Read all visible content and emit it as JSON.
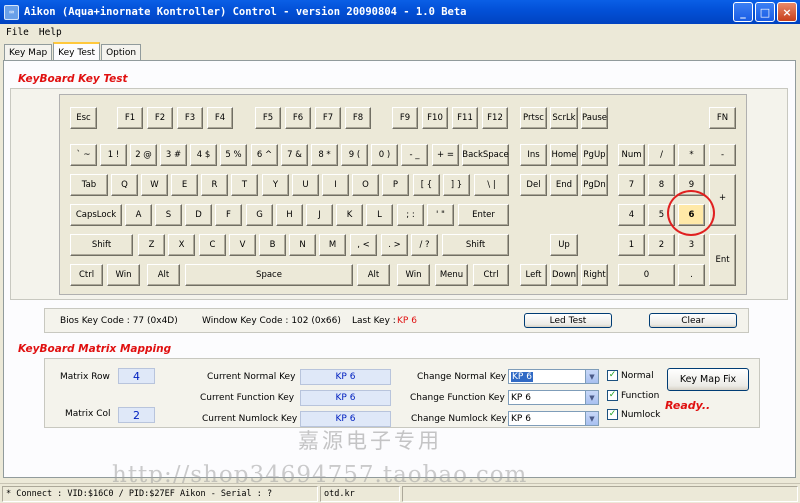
{
  "window": {
    "title": "Aikon (Aqua+inornate Kontroller) Control - version 20090804 - 1.0 Beta",
    "min": "_",
    "max": "□",
    "close": "×"
  },
  "menu": [
    "File",
    "Help"
  ],
  "tabs": [
    "Key Map",
    "Key Test",
    "Option"
  ],
  "keyboard_section": {
    "title": "KeyBoard Key Test"
  },
  "keys": [
    {
      "label": "Esc"
    },
    {
      "label": "F1"
    },
    {
      "label": "F2"
    },
    {
      "label": "F3"
    },
    {
      "label": "F4"
    },
    {
      "label": "F5"
    },
    {
      "label": "F6"
    },
    {
      "label": "F7"
    },
    {
      "label": "F8"
    },
    {
      "label": "F9"
    },
    {
      "label": "F10"
    },
    {
      "label": "F11"
    },
    {
      "label": "F12"
    },
    {
      "label": "Prtsc"
    },
    {
      "label": "ScrLk"
    },
    {
      "label": "Pause"
    },
    {
      "label": "FN"
    },
    {
      "label": "` ~"
    },
    {
      "label": "1 !"
    },
    {
      "label": "2 @"
    },
    {
      "label": "3 #"
    },
    {
      "label": "4 $"
    },
    {
      "label": "5 %"
    },
    {
      "label": "6 ^"
    },
    {
      "label": "7 &"
    },
    {
      "label": "8 *"
    },
    {
      "label": "9 ("
    },
    {
      "label": "0 )"
    },
    {
      "label": "- _"
    },
    {
      "label": "+ ="
    },
    {
      "label": "BackSpace"
    },
    {
      "label": "Ins"
    },
    {
      "label": "Home"
    },
    {
      "label": "PgUp"
    },
    {
      "label": "Num"
    },
    {
      "label": "/"
    },
    {
      "label": "*"
    },
    {
      "label": "-"
    },
    {
      "label": "Tab"
    },
    {
      "label": "Q"
    },
    {
      "label": "W"
    },
    {
      "label": "E"
    },
    {
      "label": "R"
    },
    {
      "label": "T"
    },
    {
      "label": "Y"
    },
    {
      "label": "U"
    },
    {
      "label": "I"
    },
    {
      "label": "O"
    },
    {
      "label": "P"
    },
    {
      "label": "[ {"
    },
    {
      "label": "] }"
    },
    {
      "label": "\\ |"
    },
    {
      "label": "Del"
    },
    {
      "label": "End"
    },
    {
      "label": "PgDn"
    },
    {
      "label": "7"
    },
    {
      "label": "8"
    },
    {
      "label": "9"
    },
    {
      "label": "+"
    },
    {
      "label": "CapsLock"
    },
    {
      "label": "A"
    },
    {
      "label": "S"
    },
    {
      "label": "D"
    },
    {
      "label": "F"
    },
    {
      "label": "G"
    },
    {
      "label": "H"
    },
    {
      "label": "J"
    },
    {
      "label": "K"
    },
    {
      "label": "L"
    },
    {
      "label": "; :"
    },
    {
      "label": "' \""
    },
    {
      "label": "Enter"
    },
    {
      "label": "4"
    },
    {
      "label": "5"
    },
    {
      "label": "6",
      "highlight": true
    },
    {
      "label": "Shift"
    },
    {
      "label": "Z"
    },
    {
      "label": "X"
    },
    {
      "label": "C"
    },
    {
      "label": "V"
    },
    {
      "label": "B"
    },
    {
      "label": "N"
    },
    {
      "label": "M"
    },
    {
      "label": ", <"
    },
    {
      "label": ". >"
    },
    {
      "label": "/ ?"
    },
    {
      "label": "Shift"
    },
    {
      "label": "Up"
    },
    {
      "label": "1"
    },
    {
      "label": "2"
    },
    {
      "label": "3"
    },
    {
      "label": "Ent"
    },
    {
      "label": "Ctrl"
    },
    {
      "label": "Win"
    },
    {
      "label": "Alt"
    },
    {
      "label": "Space"
    },
    {
      "label": "Alt"
    },
    {
      "label": "Win"
    },
    {
      "label": "Menu"
    },
    {
      "label": "Ctrl"
    },
    {
      "label": "Left"
    },
    {
      "label": "Down"
    },
    {
      "label": "Right"
    },
    {
      "label": "0"
    },
    {
      "label": "."
    }
  ],
  "info": {
    "bios_label": "Bios Key Code : 77 (0x4D)",
    "window_label": "Window Key Code : 102 (0x66)",
    "last_key_label": "Last Key :",
    "last_key_value": "KP 6",
    "led_test": "Led Test",
    "clear": "Clear"
  },
  "matrix_section": {
    "title": "KeyBoard Matrix Mapping",
    "row_label": "Matrix Row",
    "row_value": "4",
    "col_label": "Matrix Col",
    "col_value": "2",
    "current": [
      {
        "label": "Current Normal Key",
        "value": "KP 6"
      },
      {
        "label": "Current Function Key",
        "value": "KP 6"
      },
      {
        "label": "Current Numlock Key",
        "value": "KP 6"
      }
    ],
    "change": [
      {
        "label": "Change Normal Key",
        "value": "KP 6",
        "selected": true
      },
      {
        "label": "Change Function Key",
        "value": "KP 6"
      },
      {
        "label": "Change Numlock Key",
        "value": "KP 6"
      }
    ],
    "checks": [
      {
        "label": "Normal",
        "checked": true
      },
      {
        "label": "Function",
        "checked": true
      },
      {
        "label": "Numlock",
        "checked": true
      }
    ],
    "fix_button": "Key Map Fix",
    "ready": "Ready.."
  },
  "watermark": {
    "line1": "嘉源电子专用",
    "line2": "http://shop34694757.taobao.com"
  },
  "status": {
    "connect": "* Connect : VID:$16C0 / PID:$27EF Aikon - Serial : ?",
    "file": "otd.kr"
  }
}
